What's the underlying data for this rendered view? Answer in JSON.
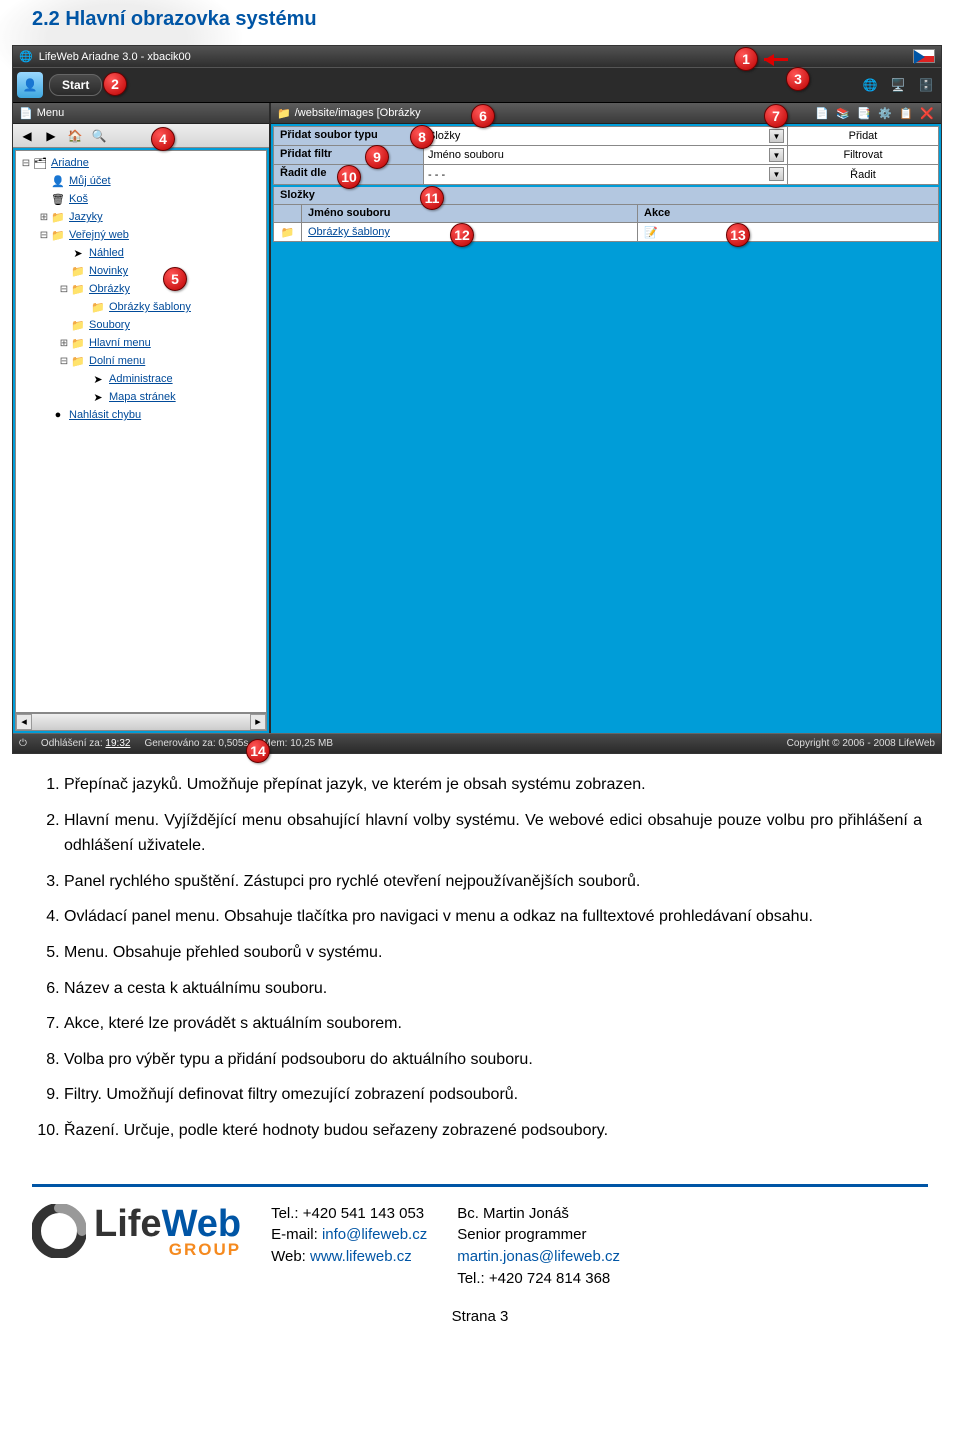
{
  "heading": "2.2  Hlavní obrazovka systému",
  "window": {
    "title": "LifeWeb Ariadne 3.0 - xbacik00",
    "start": "Start",
    "menu_label": "Menu",
    "path_label": "/website/images [Obrázky",
    "controls": [
      {
        "label": "Přidat soubor typu",
        "select": "Složky",
        "button": "Přidat"
      },
      {
        "label": "Přidat filtr",
        "select": "Jméno souboru",
        "button": "Filtrovat"
      },
      {
        "label": "Řadit dle",
        "select": "- - -",
        "button": "Řadit"
      }
    ],
    "folders_header": "Složky",
    "table_headers": {
      "name": "Jméno souboru",
      "action": "Akce"
    },
    "table_row": {
      "name": "Obrázky šablony"
    },
    "tree": [
      {
        "indent": 0,
        "exp": "⊟",
        "icon": "🗂",
        "label": "Ariadne",
        "link": true
      },
      {
        "indent": 1,
        "exp": "",
        "icon": "👤",
        "label": "Můj účet",
        "link": true
      },
      {
        "indent": 1,
        "exp": "",
        "icon": "🗑",
        "label": "Koš",
        "link": true
      },
      {
        "indent": 1,
        "exp": "⊞",
        "icon": "📁",
        "label": "Jazyky",
        "link": true
      },
      {
        "indent": 1,
        "exp": "⊟",
        "icon": "📁",
        "label": "Veřejný web",
        "link": true
      },
      {
        "indent": 2,
        "exp": "",
        "icon": "➤",
        "label": "Náhled",
        "link": true
      },
      {
        "indent": 2,
        "exp": "",
        "icon": "📁",
        "label": "Novinky",
        "link": true
      },
      {
        "indent": 2,
        "exp": "⊟",
        "icon": "📁",
        "label": "Obrázky",
        "link": true
      },
      {
        "indent": 3,
        "exp": "",
        "icon": "📁",
        "label": "Obrázky šablony",
        "link": true
      },
      {
        "indent": 2,
        "exp": "",
        "icon": "📁",
        "label": "Soubory",
        "link": true
      },
      {
        "indent": 2,
        "exp": "⊞",
        "icon": "📁",
        "label": "Hlavní menu",
        "link": true
      },
      {
        "indent": 2,
        "exp": "⊟",
        "icon": "📁",
        "label": "Dolní menu",
        "link": true
      },
      {
        "indent": 3,
        "exp": "",
        "icon": "➤",
        "label": "Administrace",
        "link": true
      },
      {
        "indent": 3,
        "exp": "",
        "icon": "➤",
        "label": "Mapa stránek",
        "link": true
      },
      {
        "indent": 1,
        "exp": "",
        "icon": "●",
        "label": "Nahlásit chybu",
        "link": true
      }
    ],
    "status": {
      "logout_label": "Odhlášení za:",
      "logout_value": "19:32",
      "gen_label": "Generováno za:",
      "gen_value": "0,505s",
      "mem_label": "Mem:",
      "mem_value": "10,25 MB",
      "copyright": "Copyright © 2006 - 2008 LifeWeb"
    }
  },
  "callouts": [
    "1",
    "2",
    "3",
    "4",
    "5",
    "6",
    "7",
    "8",
    "9",
    "10",
    "11",
    "12",
    "13",
    "14"
  ],
  "descriptions": [
    "Přepínač jazyků. Umožňuje přepínat jazyk, ve kterém je obsah systému zobrazen.",
    "Hlavní menu. Vyjíždějící menu obsahující hlavní volby systému. Ve webové edici obsahuje pouze volbu pro přihlášení a odhlášení uživatele.",
    "Panel rychlého spuštění. Zástupci pro rychlé otevření nejpoužívanějších souborů.",
    "Ovládací panel menu. Obsahuje tlačítka pro navigaci v menu a odkaz na fulltextové prohledávaní obsahu.",
    "Menu. Obsahuje přehled souborů v systému.",
    "Název a cesta k aktuálnímu souboru.",
    "Akce, které lze provádět s aktuálním souborem.",
    "Volba pro výběr typu a přidání podsouboru do aktuálního souboru.",
    "Filtry. Umožňují definovat filtry omezující zobrazení podsouborů.",
    "Řazení. Určuje, podle které hodnoty budou seřazeny zobrazené podsoubory."
  ],
  "footer": {
    "tel_label": "Tel.:",
    "tel": "+420 541 143 053",
    "email_label": "E-mail:",
    "email": "info@lifeweb.cz",
    "web_label": "Web:",
    "web": "www.lifeweb.cz",
    "name": "Bc. Martin Jonáš",
    "role": "Senior programmer",
    "email2": "martin.jonas@lifeweb.cz",
    "tel2_label": "Tel.:",
    "tel2": "+420 724 814 368",
    "page": "Strana 3",
    "logo_life": "Life",
    "logo_web": "Web",
    "logo_group": "GROUP"
  }
}
